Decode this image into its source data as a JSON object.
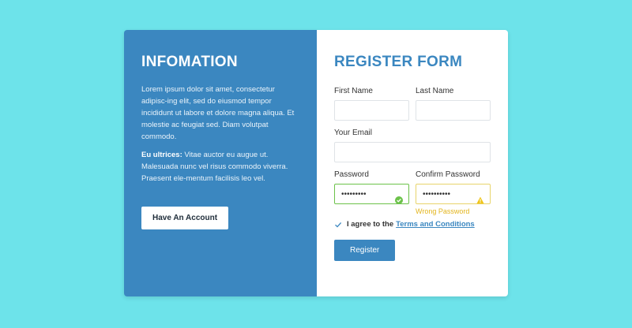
{
  "info": {
    "title": "INFOMATION",
    "paragraph1": "Lorem ipsum dolor sit amet, consectetur adipisc-ing elit, sed do eiusmod tempor incididunt ut labore et dolore magna aliqua. Et molestie ac feugiat sed. Diam volutpat commodo.",
    "paragraph2_bold": "Eu ultrices:",
    "paragraph2_rest": " Vitae auctor eu augue ut. Malesuada nunc vel risus commodo viverra. Praesent ele-mentum facilisis leo vel.",
    "account_button": "Have An Account"
  },
  "form": {
    "title": "REGISTER FORM",
    "first_name_label": "First Name",
    "last_name_label": "Last Name",
    "email_label": "Your Email",
    "password_label": "Password",
    "password_value": "•••••••••",
    "confirm_label": "Confirm Password",
    "confirm_value": "••••••••••",
    "confirm_error": "Wrong Password",
    "agree_text": "I agree to the",
    "terms_link": "Terms and Conditions",
    "register_button": "Register"
  },
  "colors": {
    "background": "#6de3ea",
    "accent": "#3b87c0",
    "success": "#6cc24a",
    "warning": "#e3b51d"
  },
  "icons": {
    "password_status": "check-circle-icon",
    "confirm_status": "warning-triangle-icon",
    "agree_checkbox": "check-icon"
  }
}
